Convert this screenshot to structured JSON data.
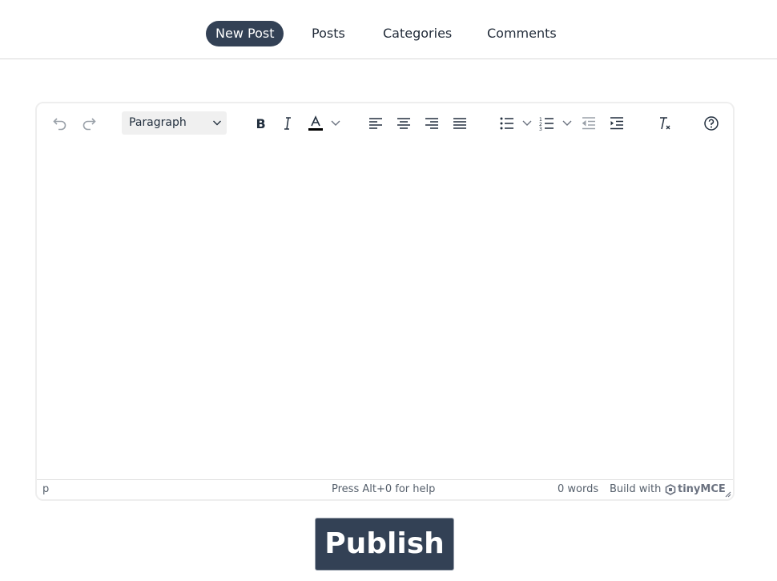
{
  "nav": {
    "items": [
      {
        "label": "New Post",
        "active": true
      },
      {
        "label": "Posts",
        "active": false
      },
      {
        "label": "Categories",
        "active": false
      },
      {
        "label": "Comments",
        "active": false
      }
    ]
  },
  "editor": {
    "toolbar": {
      "block_format": "Paragraph",
      "icons": [
        "undo-icon",
        "redo-icon",
        "bold-icon",
        "italic-icon",
        "text-color-icon",
        "align-left-icon",
        "align-center-icon",
        "align-right-icon",
        "justify-icon",
        "bullet-list-icon",
        "numbered-list-icon",
        "outdent-icon",
        "indent-icon",
        "clear-formatting-icon",
        "help-icon"
      ]
    },
    "content": "",
    "statusbar": {
      "path": "p",
      "help": "Press Alt+0 for help",
      "word_count": "0 words",
      "branding": "Build with",
      "brand_name": "tinyMCE"
    }
  },
  "publish_label": "Publish",
  "colors": {
    "accent": "#334155",
    "text_color_swatch": "#000000"
  }
}
